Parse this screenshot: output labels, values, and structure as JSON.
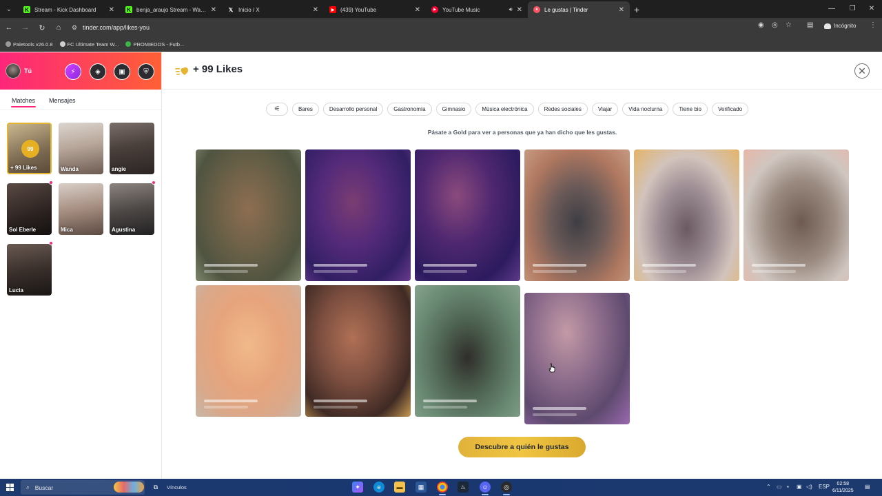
{
  "browser": {
    "tabs": [
      {
        "title": "Stream - Kick Dashboard",
        "favicon": "kick-icon",
        "color": "#53fc18",
        "letter": "K"
      },
      {
        "title": "benja_araujo Stream - Watch L",
        "favicon": "kick-icon",
        "color": "#53fc18",
        "letter": "K"
      },
      {
        "title": "Inicio / X",
        "favicon": "x-icon",
        "color": "#1f1f1f",
        "letter": "X"
      },
      {
        "title": "(439) YouTube",
        "favicon": "youtube-icon",
        "color": "#ff0000",
        "letter": "▶"
      },
      {
        "title": "YouTube Music",
        "favicon": "youtube-music-icon",
        "color": "#ff0033",
        "letter": "●"
      },
      {
        "title": "Le gustas | Tinder",
        "favicon": "tinder-icon",
        "color": "#fd5564",
        "letter": "♦"
      }
    ],
    "url": "tinder.com/app/likes-you",
    "incognito_label": "Incógnito",
    "bookmarks": [
      {
        "label": "Paletools v26.0.8",
        "color": "#9a9a9a"
      },
      {
        "label": "FC Ultimate Team W...",
        "color": "#cfcfcf"
      },
      {
        "label": "PROMIEDOS - Futb...",
        "color": "#3bb54a"
      }
    ]
  },
  "sidebar": {
    "user_name": "Tú",
    "tabs": [
      "Matches",
      "Mensajes"
    ],
    "likes_card": {
      "badge": "99",
      "label": "+ 99 Likes"
    },
    "matches": [
      {
        "name": "Wanda",
        "new": false
      },
      {
        "name": "angie",
        "new": false
      },
      {
        "name": "Sol Eberle",
        "new": true
      },
      {
        "name": "Mica",
        "new": false
      },
      {
        "name": "Agustina",
        "new": true
      },
      {
        "name": "Lucia",
        "new": true
      }
    ]
  },
  "main": {
    "title": "+ 99 Likes",
    "filters": [
      "Bares",
      "Desarrollo personal",
      "Gastronomía",
      "Gimnasio",
      "Música electrónica",
      "Redes sociales",
      "Viajar",
      "Vida nocturna",
      "Tiene bio",
      "Verificado"
    ],
    "upsell_text": "Pásate a Gold para ver a personas que ya han dicho que les gustas.",
    "cta_label": "Descubre a quién le gustas",
    "liked_by_count": 10
  },
  "taskbar": {
    "search_label": "Buscar",
    "links_label": "Vínculos",
    "language": "ESP",
    "time": "02:58",
    "date": "6/11/2025"
  }
}
